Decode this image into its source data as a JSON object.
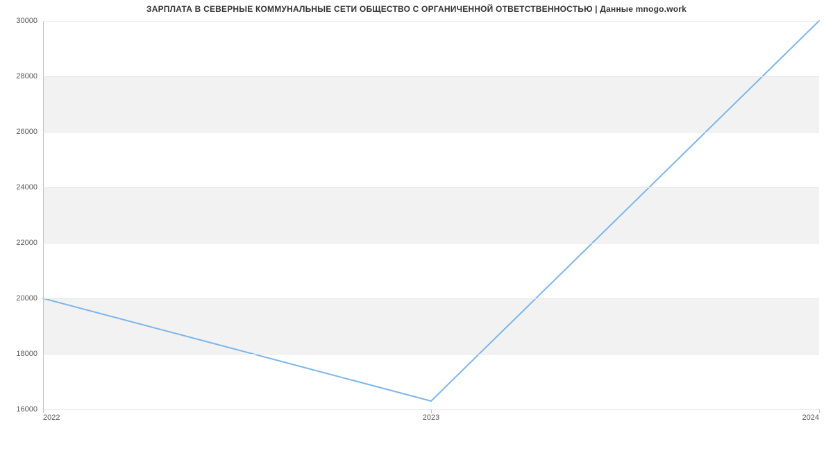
{
  "chart_data": {
    "type": "line",
    "title": "ЗАРПЛАТА В СЕВЕРНЫЕ КОММУНАЛЬНЫЕ СЕТИ ОБЩЕСТВО С ОРГАНИЧЕННОЙ ОТВЕТСТВЕННОСТЬЮ | Данные mnogo.work",
    "xlabel": "",
    "ylabel": "",
    "x_ticks": [
      "2022",
      "2023",
      "2024"
    ],
    "y_ticks": [
      16000,
      18000,
      20000,
      22000,
      24000,
      26000,
      28000,
      30000
    ],
    "ylim": [
      16000,
      30000
    ],
    "x": [
      2022,
      2023,
      2024
    ],
    "values": [
      20000,
      16300,
      30000
    ],
    "line_color": "#7cb5ec",
    "band_color": "#f2f2f2",
    "grid": true
  }
}
